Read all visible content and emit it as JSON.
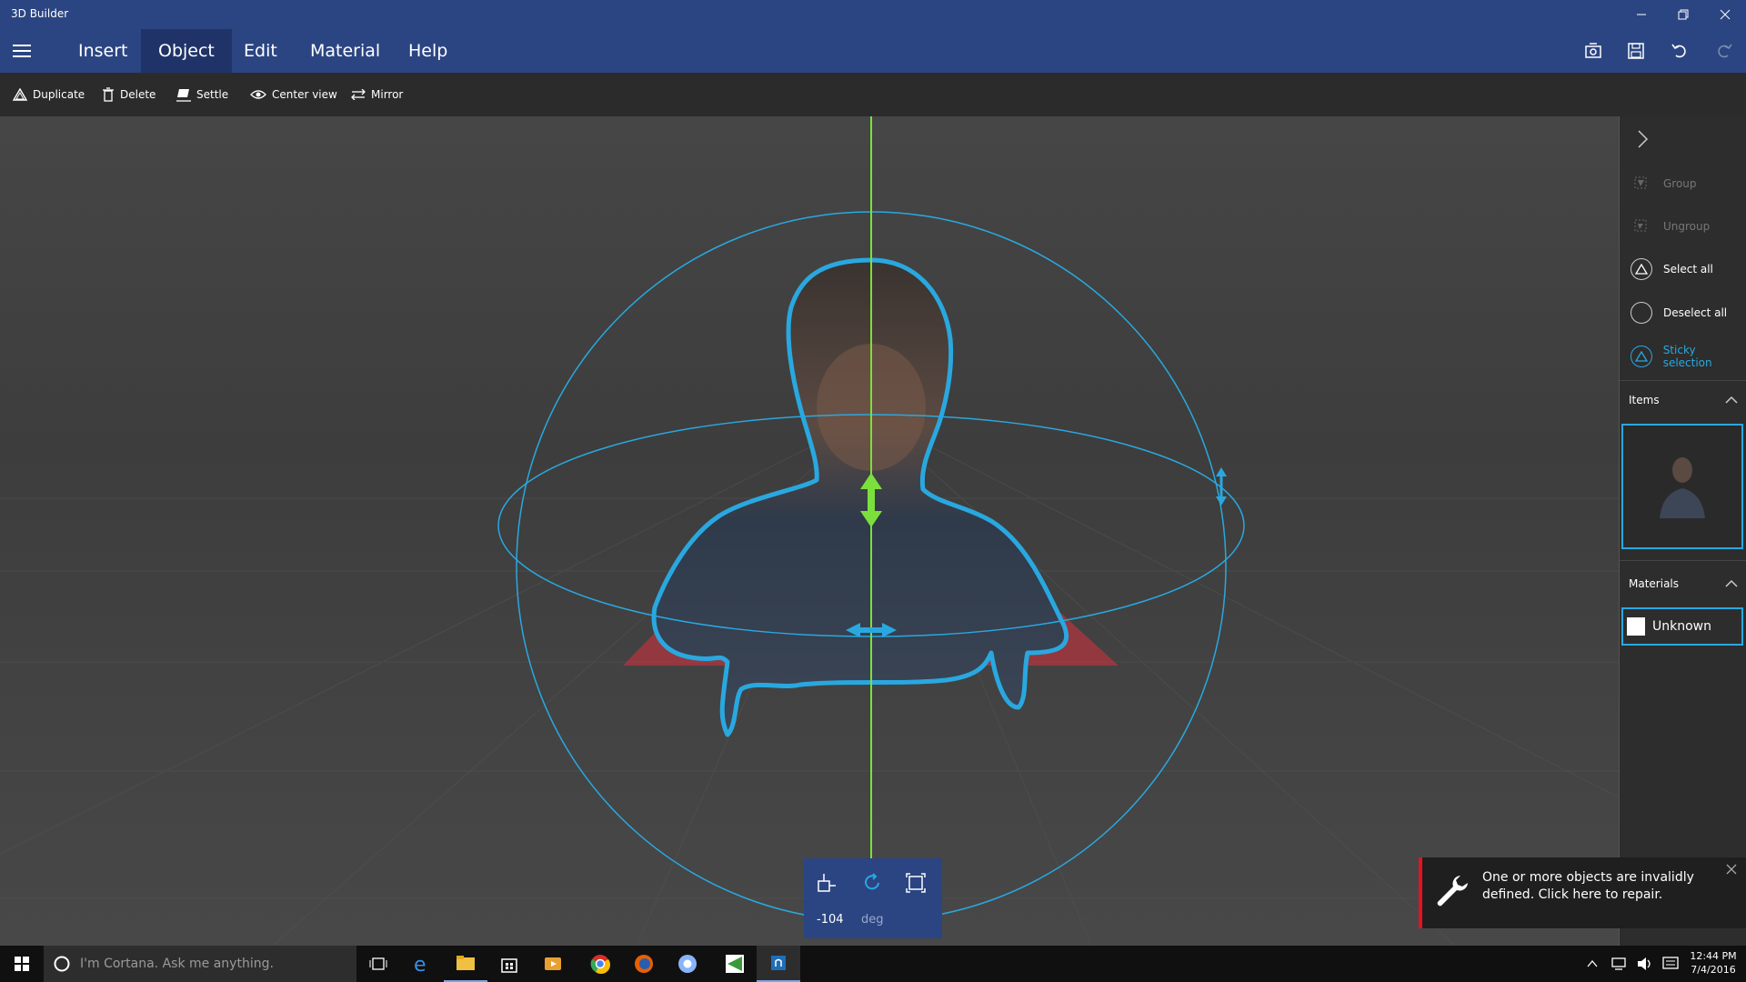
{
  "app": {
    "title": "3D Builder"
  },
  "menu": {
    "tabs": [
      {
        "label": "Insert"
      },
      {
        "label": "Object"
      },
      {
        "label": "Edit"
      },
      {
        "label": "Material"
      },
      {
        "label": "Help"
      }
    ],
    "active_tab": "Object"
  },
  "toolbar": {
    "duplicate": "Duplicate",
    "delete": "Delete",
    "settle": "Settle",
    "center_view": "Center view",
    "mirror": "Mirror"
  },
  "panel": {
    "group": "Group",
    "ungroup": "Ungroup",
    "select_all": "Select all",
    "deselect_all": "Deselect all",
    "sticky_selection": "Sticky selection",
    "items_header": "Items",
    "materials_header": "Materials",
    "material_name": "Unknown"
  },
  "rotation": {
    "value": "-104",
    "unit": "deg"
  },
  "notification": {
    "text": "One or more objects are invalidly defined. Click here to repair."
  },
  "taskbar": {
    "search_placeholder": "I'm Cortana. Ask me anything.",
    "time": "12:44 PM",
    "date": "7/4/2016"
  },
  "colors": {
    "titlebar": "#2b4582",
    "accent_blue": "#29a8e0",
    "gizmo_green": "#7be03c",
    "error_red": "#e81123"
  }
}
